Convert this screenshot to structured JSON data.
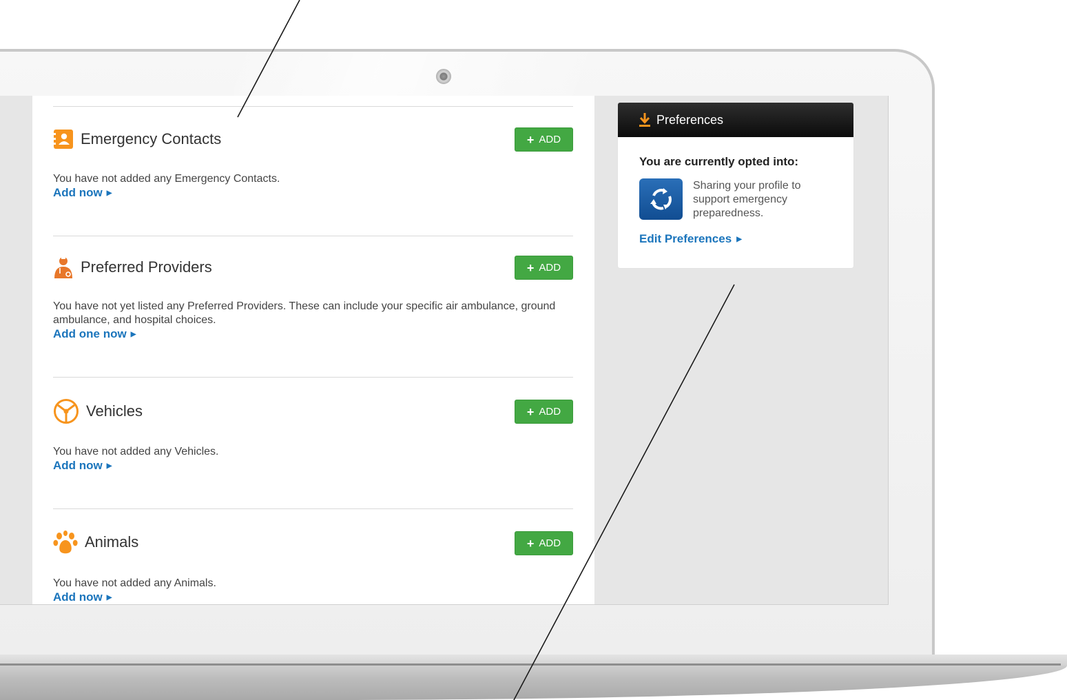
{
  "sections": [
    {
      "title": "Emergency Contacts",
      "description": "You have not added any Emergency Contacts.",
      "link": "Add now",
      "button": "ADD",
      "icon": "contact-card-icon"
    },
    {
      "title": "Preferred Providers",
      "description": "You have not yet listed any Preferred Providers. These can include your specific air ambulance, ground ambulance, and hospital choices.",
      "link": "Add one now",
      "button": "ADD",
      "icon": "provider-person-icon"
    },
    {
      "title": "Vehicles",
      "description": "You have not added any Vehicles.",
      "link": "Add now",
      "button": "ADD",
      "icon": "steering-wheel-icon"
    },
    {
      "title": "Animals",
      "description": "You have not added any Animals.",
      "link": "Add now",
      "button": "ADD",
      "icon": "paw-icon"
    }
  ],
  "preferences": {
    "title": "Preferences",
    "opted_label": "You are currently opted into:",
    "item_text": "Sharing your profile to support emergency preparedness.",
    "edit_link": "Edit Preferences",
    "icon": "download-icon",
    "tile_icon": "refresh-cycle-icon"
  },
  "colors": {
    "add_button": "#43a843",
    "link": "#1b75bc",
    "icon_orange": "#f7941d",
    "header_dark": "#111111",
    "tile_blue": "#1a5ea8"
  }
}
